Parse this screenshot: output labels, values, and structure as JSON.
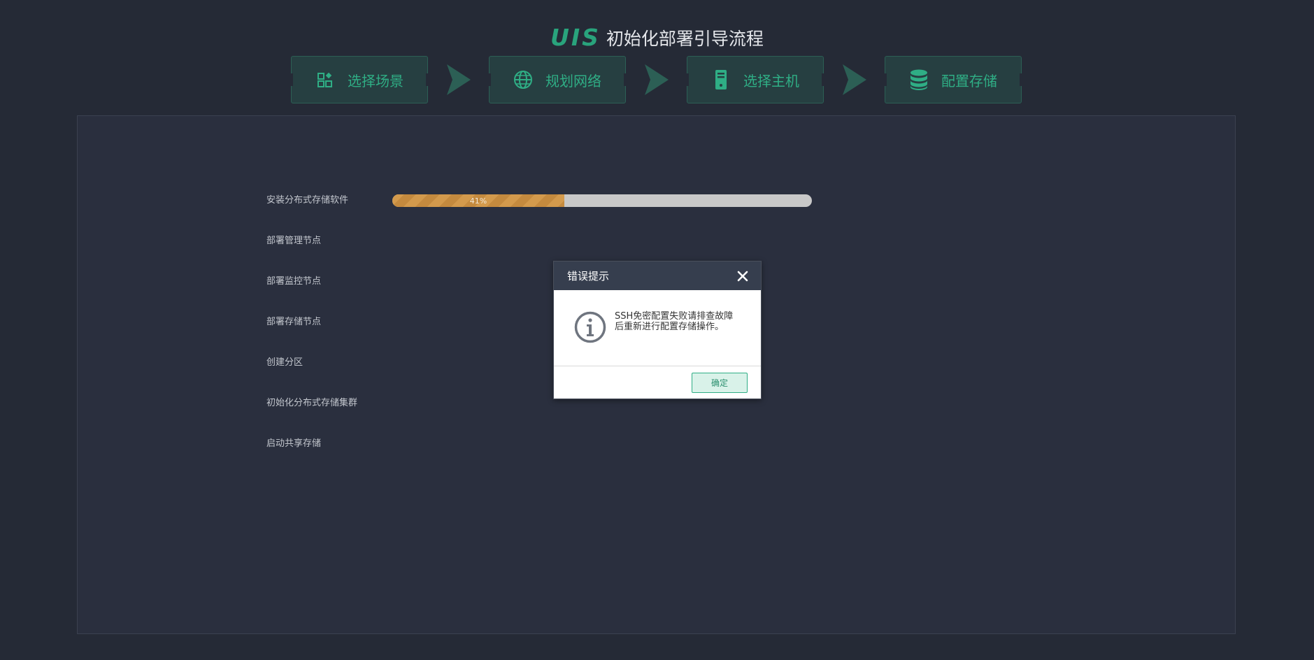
{
  "header": {
    "logo": "UIS",
    "title": "初始化部署引导流程"
  },
  "steps": [
    {
      "label": "选择场景",
      "icon": "scene-grid-icon"
    },
    {
      "label": "规划网络",
      "icon": "globe-icon"
    },
    {
      "label": "选择主机",
      "icon": "server-icon"
    },
    {
      "label": "配置存储",
      "icon": "database-icon"
    }
  ],
  "tasks": [
    {
      "label": "安装分布式存储软件",
      "progress": 0.41,
      "progress_text": "41%"
    },
    {
      "label": "部署管理节点"
    },
    {
      "label": "部署监控节点"
    },
    {
      "label": "部署存储节点"
    },
    {
      "label": "创建分区"
    },
    {
      "label": "初始化分布式存储集群"
    },
    {
      "label": "启动共享存储"
    }
  ],
  "dialog": {
    "title": "错误提示",
    "message": "SSH免密配置失败请排查故障后重新进行配置存储操作。",
    "ok_label": "确定"
  },
  "colors": {
    "accent": "#2fae85",
    "background": "#252a36",
    "panel": "#2a2f3e",
    "progress_fill": "#d39a4c"
  }
}
